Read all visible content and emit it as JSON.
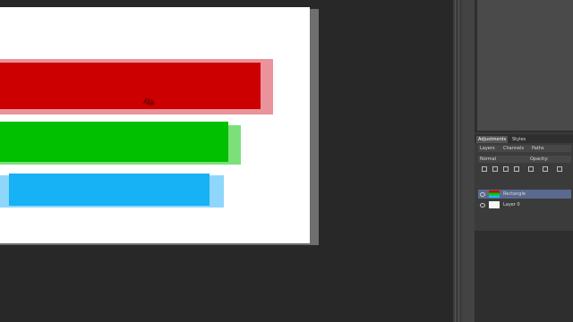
{
  "canvas": {
    "bars": [
      {
        "name": "red",
        "color": "#cc0000"
      },
      {
        "name": "green",
        "color": "#00c000"
      },
      {
        "name": "blue",
        "color": "#17b1f5"
      }
    ],
    "cursor_label": "ʎʃᶃ"
  },
  "layers_panel": {
    "tabs": [
      "Adjustments",
      "Styles"
    ],
    "sub_tabs": [
      "Layers",
      "Channels",
      "Paths"
    ],
    "blend_mode": "Normal",
    "opacity_label": "Opacity:",
    "layers": [
      {
        "name": "Rectangle",
        "selected": true
      },
      {
        "name": "Layer 0",
        "selected": false
      }
    ]
  }
}
